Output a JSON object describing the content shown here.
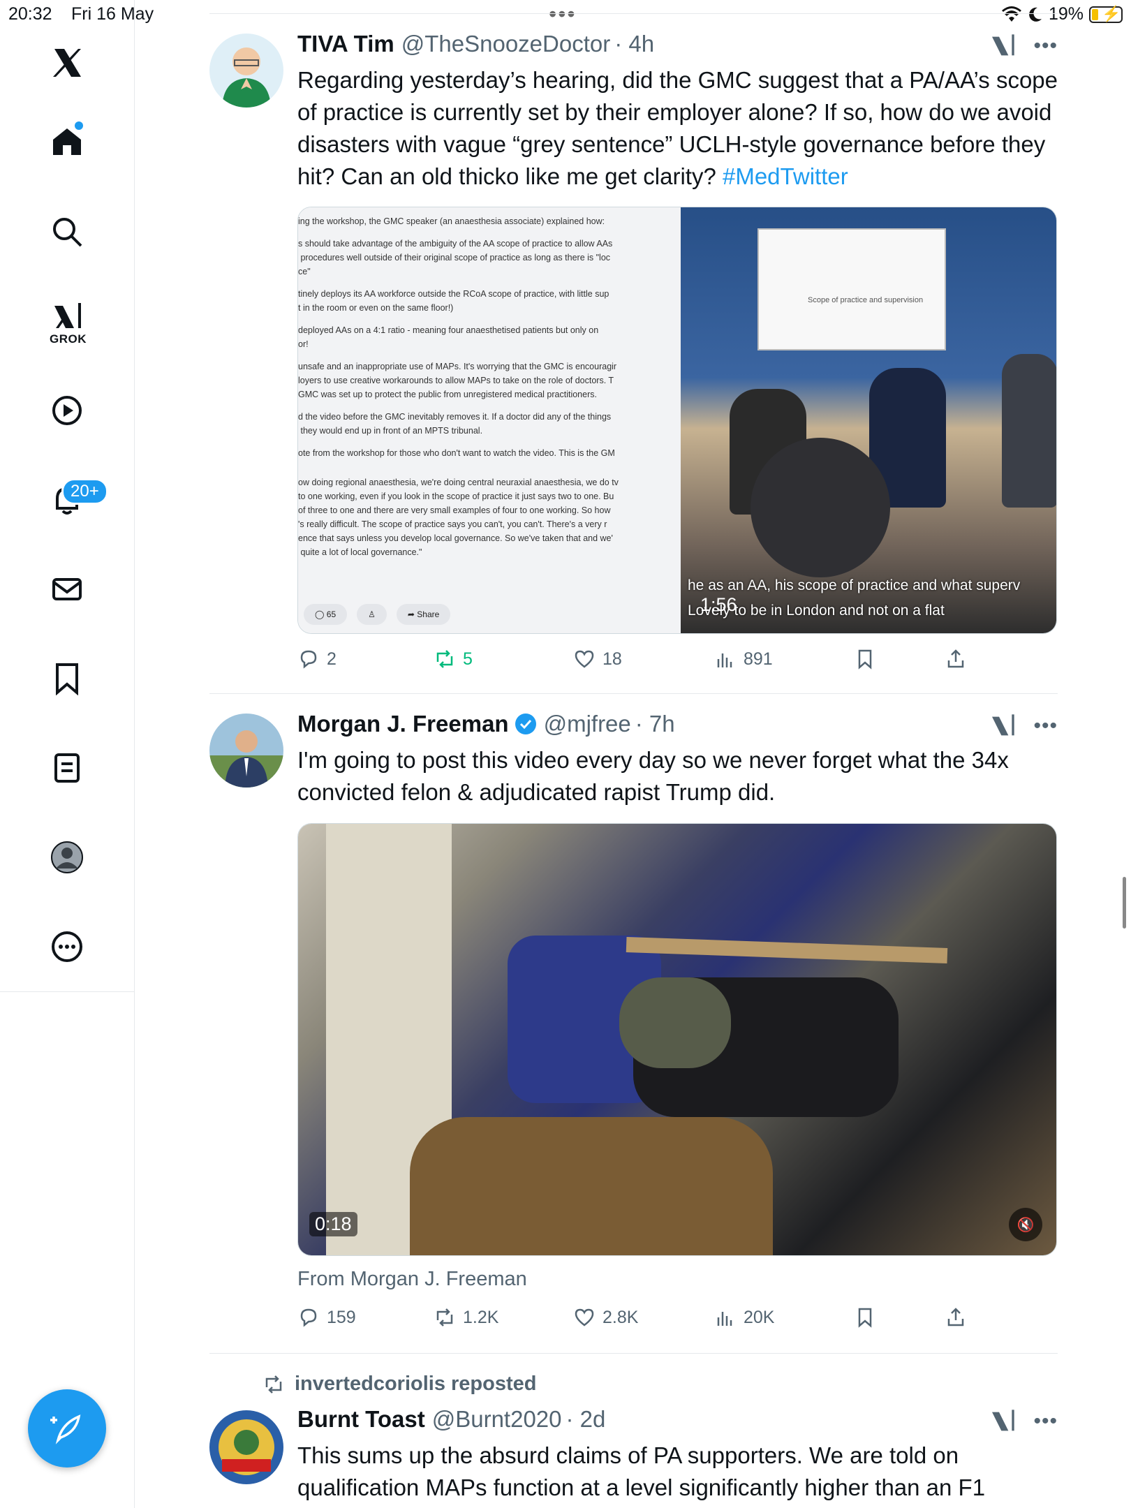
{
  "status_bar": {
    "time": "20:32",
    "date": "Fri 16 May",
    "battery": "19%"
  },
  "sidebar": {
    "items": [
      "home",
      "search",
      "grok",
      "videos",
      "notifications",
      "messages",
      "bookmarks",
      "lists",
      "profile",
      "more"
    ],
    "grok_label": "GROK",
    "notifications_badge": "20+"
  },
  "posts": [
    {
      "name": "TIVA Tim",
      "handle": "@TheSnoozeDoctor",
      "time": "· 4h",
      "text": "Regarding yesterday’s hearing, did the GMC suggest that a PA/AA’s scope of practice is currently set by their employer alone? If so, how do we avoid disasters with vague “grey sentence” UCLH-style governance before they hit? Can an old thicko like me get clarity? ",
      "hashtag": "#MedTwitter",
      "doc_lines": [
        "ing the workshop, the GMC speaker (an anaesthesia associate) explained how:",
        "s should take advantage of the ambiguity of the AA scope of practice to allow AAs\n procedures well outside of their original scope of practice as long as there is \"loc\nce\"",
        "tinely deploys its AA workforce outside the RCoA scope of practice, with little sup\nt in the room or even on the same floor!)",
        "deployed AAs on a 4:1 ratio - meaning four anaesthetised patients but only on\nor!",
        "unsafe and an inappropriate use of MAPs. It's worrying that the GMC is encouragir\nloyers to use creative workarounds to allow MAPs to take on the role of doctors. T\nGMC was set up to protect the public from unregistered medical practitioners.",
        "d the video before the GMC inevitably removes it. If a doctor did any of the things\n they would end up in front of an MPTS tribunal.",
        "ote from the workshop for those who don't want to watch the video. This is the GM",
        "ow doing regional anaesthesia, we're doing central neuraxial anaesthesia, we do tv\nto one working, even if you look in the scope of practice it just says two to one. Bu\nof three to one and there are very small examples of four to one working. So how\n's really difficult. The scope of practice says you can't, you can't. There's a very r\nence that says unless you develop local governance. So we've taken that and we'\n quite a lot of local governance.\""
      ],
      "doc_pills": [
        "65",
        "",
        "Share"
      ],
      "video_slide": "Scope of practice and supervision",
      "video_sub1": "he as an AA, his scope of practice and what superv",
      "video_sub2": "Lovely to be in London and not on a flat",
      "video_duration": "1:56",
      "replies": "2",
      "reposts": "5",
      "likes": "18",
      "views": "891"
    },
    {
      "name": "Morgan J. Freeman",
      "handle": "@mjfree",
      "time": "· 7h",
      "text": "I'm going to post this video every day so we never forget what the 34x convicted felon & adjudicated rapist Trump did.",
      "video_duration": "0:18",
      "from": "From Morgan J. Freeman",
      "replies": "159",
      "reposts": "1.2K",
      "likes": "2.8K",
      "views": "20K"
    },
    {
      "repost_by": "invertedcoriolis reposted",
      "name": "Burnt Toast",
      "handle": "@Burnt2020",
      "time": "· 2d",
      "text": "This sums up the absurd claims of PA supporters. We are told on qualification MAPs function at a level significantly higher than an F1"
    }
  ],
  "colors": {
    "accent": "#1d9bf0",
    "repost_active": "#00ba7c",
    "muted": "#536471"
  }
}
